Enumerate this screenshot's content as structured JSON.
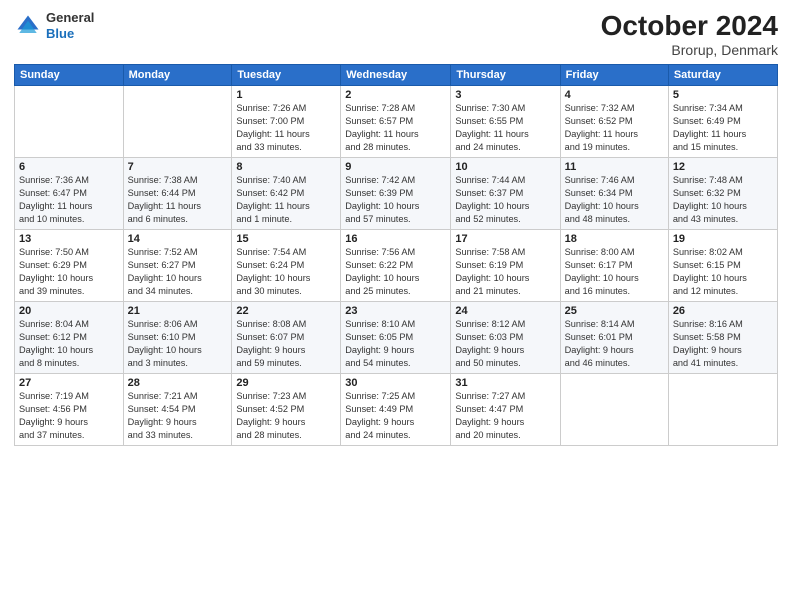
{
  "header": {
    "logo": {
      "line1": "General",
      "line2": "Blue"
    },
    "title": "October 2024",
    "location": "Brorup, Denmark"
  },
  "weekdays": [
    "Sunday",
    "Monday",
    "Tuesday",
    "Wednesday",
    "Thursday",
    "Friday",
    "Saturday"
  ],
  "weeks": [
    [
      {
        "day": "",
        "info": ""
      },
      {
        "day": "",
        "info": ""
      },
      {
        "day": "1",
        "info": "Sunrise: 7:26 AM\nSunset: 7:00 PM\nDaylight: 11 hours\nand 33 minutes."
      },
      {
        "day": "2",
        "info": "Sunrise: 7:28 AM\nSunset: 6:57 PM\nDaylight: 11 hours\nand 28 minutes."
      },
      {
        "day": "3",
        "info": "Sunrise: 7:30 AM\nSunset: 6:55 PM\nDaylight: 11 hours\nand 24 minutes."
      },
      {
        "day": "4",
        "info": "Sunrise: 7:32 AM\nSunset: 6:52 PM\nDaylight: 11 hours\nand 19 minutes."
      },
      {
        "day": "5",
        "info": "Sunrise: 7:34 AM\nSunset: 6:49 PM\nDaylight: 11 hours\nand 15 minutes."
      }
    ],
    [
      {
        "day": "6",
        "info": "Sunrise: 7:36 AM\nSunset: 6:47 PM\nDaylight: 11 hours\nand 10 minutes."
      },
      {
        "day": "7",
        "info": "Sunrise: 7:38 AM\nSunset: 6:44 PM\nDaylight: 11 hours\nand 6 minutes."
      },
      {
        "day": "8",
        "info": "Sunrise: 7:40 AM\nSunset: 6:42 PM\nDaylight: 11 hours\nand 1 minute."
      },
      {
        "day": "9",
        "info": "Sunrise: 7:42 AM\nSunset: 6:39 PM\nDaylight: 10 hours\nand 57 minutes."
      },
      {
        "day": "10",
        "info": "Sunrise: 7:44 AM\nSunset: 6:37 PM\nDaylight: 10 hours\nand 52 minutes."
      },
      {
        "day": "11",
        "info": "Sunrise: 7:46 AM\nSunset: 6:34 PM\nDaylight: 10 hours\nand 48 minutes."
      },
      {
        "day": "12",
        "info": "Sunrise: 7:48 AM\nSunset: 6:32 PM\nDaylight: 10 hours\nand 43 minutes."
      }
    ],
    [
      {
        "day": "13",
        "info": "Sunrise: 7:50 AM\nSunset: 6:29 PM\nDaylight: 10 hours\nand 39 minutes."
      },
      {
        "day": "14",
        "info": "Sunrise: 7:52 AM\nSunset: 6:27 PM\nDaylight: 10 hours\nand 34 minutes."
      },
      {
        "day": "15",
        "info": "Sunrise: 7:54 AM\nSunset: 6:24 PM\nDaylight: 10 hours\nand 30 minutes."
      },
      {
        "day": "16",
        "info": "Sunrise: 7:56 AM\nSunset: 6:22 PM\nDaylight: 10 hours\nand 25 minutes."
      },
      {
        "day": "17",
        "info": "Sunrise: 7:58 AM\nSunset: 6:19 PM\nDaylight: 10 hours\nand 21 minutes."
      },
      {
        "day": "18",
        "info": "Sunrise: 8:00 AM\nSunset: 6:17 PM\nDaylight: 10 hours\nand 16 minutes."
      },
      {
        "day": "19",
        "info": "Sunrise: 8:02 AM\nSunset: 6:15 PM\nDaylight: 10 hours\nand 12 minutes."
      }
    ],
    [
      {
        "day": "20",
        "info": "Sunrise: 8:04 AM\nSunset: 6:12 PM\nDaylight: 10 hours\nand 8 minutes."
      },
      {
        "day": "21",
        "info": "Sunrise: 8:06 AM\nSunset: 6:10 PM\nDaylight: 10 hours\nand 3 minutes."
      },
      {
        "day": "22",
        "info": "Sunrise: 8:08 AM\nSunset: 6:07 PM\nDaylight: 9 hours\nand 59 minutes."
      },
      {
        "day": "23",
        "info": "Sunrise: 8:10 AM\nSunset: 6:05 PM\nDaylight: 9 hours\nand 54 minutes."
      },
      {
        "day": "24",
        "info": "Sunrise: 8:12 AM\nSunset: 6:03 PM\nDaylight: 9 hours\nand 50 minutes."
      },
      {
        "day": "25",
        "info": "Sunrise: 8:14 AM\nSunset: 6:01 PM\nDaylight: 9 hours\nand 46 minutes."
      },
      {
        "day": "26",
        "info": "Sunrise: 8:16 AM\nSunset: 5:58 PM\nDaylight: 9 hours\nand 41 minutes."
      }
    ],
    [
      {
        "day": "27",
        "info": "Sunrise: 7:19 AM\nSunset: 4:56 PM\nDaylight: 9 hours\nand 37 minutes."
      },
      {
        "day": "28",
        "info": "Sunrise: 7:21 AM\nSunset: 4:54 PM\nDaylight: 9 hours\nand 33 minutes."
      },
      {
        "day": "29",
        "info": "Sunrise: 7:23 AM\nSunset: 4:52 PM\nDaylight: 9 hours\nand 28 minutes."
      },
      {
        "day": "30",
        "info": "Sunrise: 7:25 AM\nSunset: 4:49 PM\nDaylight: 9 hours\nand 24 minutes."
      },
      {
        "day": "31",
        "info": "Sunrise: 7:27 AM\nSunset: 4:47 PM\nDaylight: 9 hours\nand 20 minutes."
      },
      {
        "day": "",
        "info": ""
      },
      {
        "day": "",
        "info": ""
      }
    ]
  ]
}
